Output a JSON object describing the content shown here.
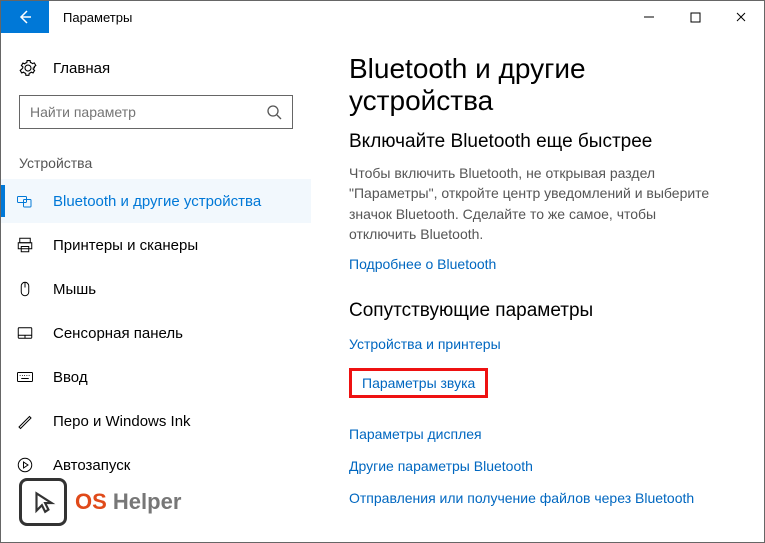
{
  "window": {
    "title": "Параметры"
  },
  "sidebar": {
    "home": "Главная",
    "search_placeholder": "Найти параметр",
    "section": "Устройства",
    "items": [
      {
        "label": "Bluetooth и другие устройства"
      },
      {
        "label": "Принтеры и сканеры"
      },
      {
        "label": "Мышь"
      },
      {
        "label": "Сенсорная панель"
      },
      {
        "label": "Ввод"
      },
      {
        "label": "Перо и Windows Ink"
      },
      {
        "label": "Автозапуск"
      }
    ]
  },
  "main": {
    "title": "Bluetooth и другие устройства",
    "sub_heading": "Включайте Bluetooth еще быстрее",
    "body": "Чтобы включить Bluetooth, не открывая раздел \"Параметры\", откройте центр уведомлений и выберите значок Bluetooth. Сделайте то же самое, чтобы отключить Bluetooth.",
    "learn_more": "Подробнее о Bluetooth",
    "related_heading": "Сопутствующие параметры",
    "links": [
      "Устройства и принтеры",
      "Параметры звука",
      "Параметры дисплея",
      "Другие параметры Bluetooth",
      "Отправления или получение файлов через Bluetooth"
    ]
  },
  "watermark": {
    "part1": "OS",
    "part2": "Helper"
  }
}
